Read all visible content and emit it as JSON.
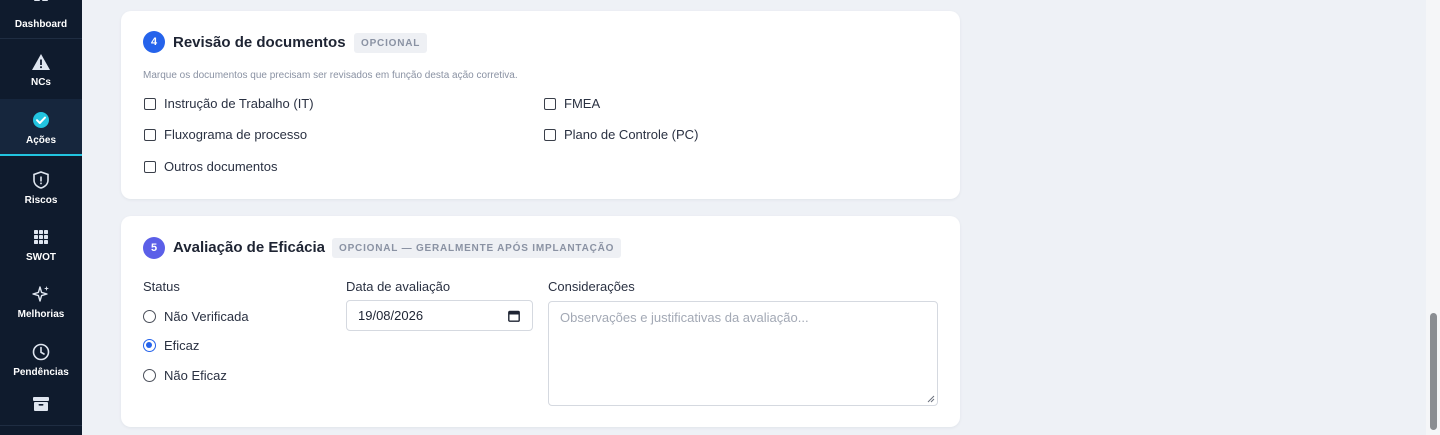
{
  "sidebar": {
    "items": [
      {
        "label": "Dashboard",
        "icon": "dashboard-icon"
      },
      {
        "label": "NCs",
        "icon": "warning-icon"
      },
      {
        "label": "Ações",
        "icon": "check-circle-icon",
        "active": true
      },
      {
        "label": "Riscos",
        "icon": "shield-alert-icon"
      },
      {
        "label": "SWOT",
        "icon": "grid-icon"
      },
      {
        "label": "Melhorias",
        "icon": "sparkles-icon"
      },
      {
        "label": "Pendências",
        "icon": "clock-icon"
      },
      {
        "label": "",
        "icon": "archive-icon"
      }
    ],
    "accent_color": "#22c4e0"
  },
  "section4": {
    "number": "4",
    "title": "Revisão de documentos",
    "badge": "OPCIONAL",
    "hint": "Marque os documentos que precisam ser revisados em função desta ação corretiva.",
    "documents": [
      {
        "label": "Instrução de Trabalho (IT)",
        "checked": false
      },
      {
        "label": "FMEA",
        "checked": false
      },
      {
        "label": "Fluxograma de processo",
        "checked": false
      },
      {
        "label": "Plano de Controle (PC)",
        "checked": false
      },
      {
        "label": "Outros documentos",
        "checked": false
      }
    ]
  },
  "section5": {
    "number": "5",
    "title": "Avaliação de Eficácia",
    "badge": "OPCIONAL — GERALMENTE APÓS IMPLANTAÇÃO",
    "status_label": "Status",
    "status_options": [
      {
        "label": "Não Verificada",
        "checked": false
      },
      {
        "label": "Eficaz",
        "checked": true
      },
      {
        "label": "Não Eficaz",
        "checked": false
      }
    ],
    "date_label": "Data de avaliação",
    "date_value": "19/08/2026",
    "considerations_label": "Considerações",
    "considerations_placeholder": "Observações e justificativas da avaliação..."
  }
}
